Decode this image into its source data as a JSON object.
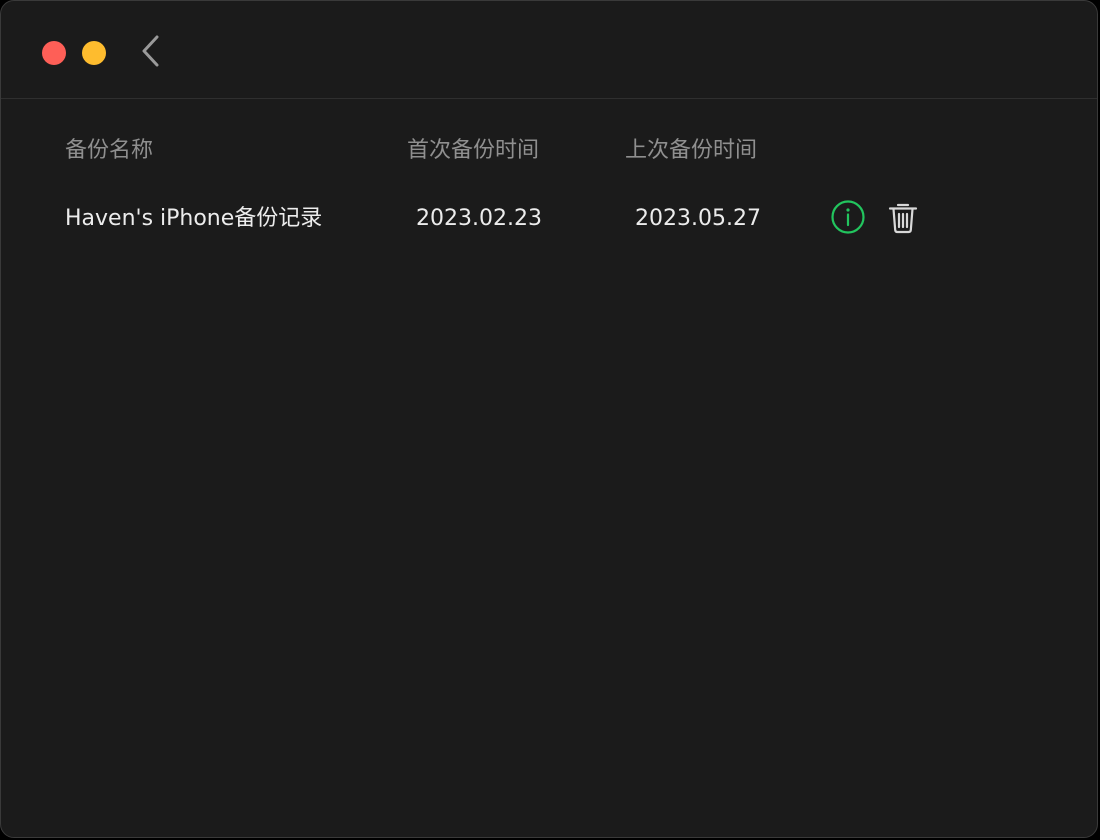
{
  "window": {
    "colors": {
      "close": "#fe5f57",
      "minimize": "#febc2e",
      "background": "#1b1b1b",
      "info_accent": "#22c55e"
    },
    "back_icon": "chevron-left-icon"
  },
  "table": {
    "headers": {
      "name": "备份名称",
      "first_backup": "首次备份时间",
      "last_backup": "上次备份时间"
    },
    "rows": [
      {
        "name": "Haven's iPhone备份记录",
        "first_backup": "2023.02.23",
        "last_backup": "2023.05.27",
        "actions": [
          "info-icon",
          "trash-icon"
        ]
      }
    ]
  }
}
